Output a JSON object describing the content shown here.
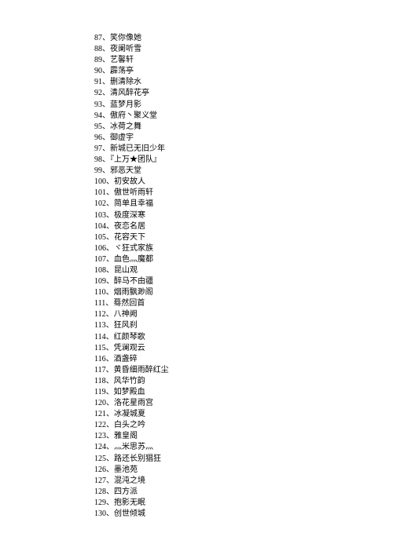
{
  "items": [
    {
      "num": "87",
      "sep": "、",
      "text": "笑你像她"
    },
    {
      "num": "88",
      "sep": "、",
      "text": "夜阑听雪"
    },
    {
      "num": "89",
      "sep": "、",
      "text": "艺馨轩"
    },
    {
      "num": "90",
      "sep": "、",
      "text": "霹荡亭"
    },
    {
      "num": "91",
      "sep": "、",
      "text": "删清除水"
    },
    {
      "num": "92",
      "sep": "、",
      "text": "清风醉花亭"
    },
    {
      "num": "93",
      "sep": "、",
      "text": "蓝梦月影"
    },
    {
      "num": "94",
      "sep": "、",
      "text": "傲府丶聚义堂"
    },
    {
      "num": "95",
      "sep": "、",
      "text": "冰荷之舞"
    },
    {
      "num": "96",
      "sep": "、",
      "text": "御虚宇"
    },
    {
      "num": "97",
      "sep": "、",
      "text": "新城已无旧少年"
    },
    {
      "num": "98",
      "sep": "、",
      "text": "『上万★团队』"
    },
    {
      "num": "99",
      "sep": "、",
      "text": "邪恶天堂"
    },
    {
      "num": "100",
      "sep": "、",
      "text": "初安故人"
    },
    {
      "num": "101",
      "sep": "、",
      "text": "傲世听雨轩"
    },
    {
      "num": "102",
      "sep": "、",
      "text": "简单且幸福"
    },
    {
      "num": "103",
      "sep": "、",
      "text": "极度深寒"
    },
    {
      "num": "104",
      "sep": "、",
      "text": "夜恋名居"
    },
    {
      "num": "105",
      "sep": "、",
      "text": "花容天下"
    },
    {
      "num": "106",
      "sep": "、",
      "text": "ヾ狂式家族"
    },
    {
      "num": "107",
      "sep": "、",
      "text": "血色灬魔都"
    },
    {
      "num": "108",
      "sep": "、",
      "text": "昆山观"
    },
    {
      "num": "109",
      "sep": "、",
      "text": "醉马不由疆"
    },
    {
      "num": "110",
      "sep": "、",
      "text": "烟雨飘渺阁"
    },
    {
      "num": "111",
      "sep": "、",
      "text": "蓦然回首"
    },
    {
      "num": "112",
      "sep": "、",
      "text": "八神阙"
    },
    {
      "num": "113",
      "sep": "、",
      "text": "狂风刹"
    },
    {
      "num": "114",
      "sep": "、",
      "text": "红颜琴歌"
    },
    {
      "num": "115",
      "sep": "、",
      "text": "凭澜观云"
    },
    {
      "num": "116",
      "sep": "、",
      "text": "酒盏碎"
    },
    {
      "num": "117",
      "sep": "、",
      "text": "黄昏细雨醉红尘"
    },
    {
      "num": "118",
      "sep": "、",
      "text": "风华竹韵"
    },
    {
      "num": "119",
      "sep": "、",
      "text": "如梦殿血"
    },
    {
      "num": "120",
      "sep": "、",
      "text": "洛花星雨宫"
    },
    {
      "num": "121",
      "sep": "、",
      "text": "冰凝城夏"
    },
    {
      "num": "122",
      "sep": "、",
      "text": "白头之吟"
    },
    {
      "num": "123",
      "sep": "、",
      "text": "雅皇阁"
    },
    {
      "num": "124",
      "sep": "、",
      "text": "灬米思苏灬"
    },
    {
      "num": "125",
      "sep": "、",
      "text": "路还长别猖狂"
    },
    {
      "num": "126",
      "sep": "、",
      "text": "墨池苑"
    },
    {
      "num": "127",
      "sep": "、",
      "text": "混沌之境"
    },
    {
      "num": "128",
      "sep": "、",
      "text": "四方派"
    },
    {
      "num": "129",
      "sep": "、",
      "text": "抱影无眠"
    },
    {
      "num": "130",
      "sep": "、",
      "text": "创世倾城"
    }
  ]
}
